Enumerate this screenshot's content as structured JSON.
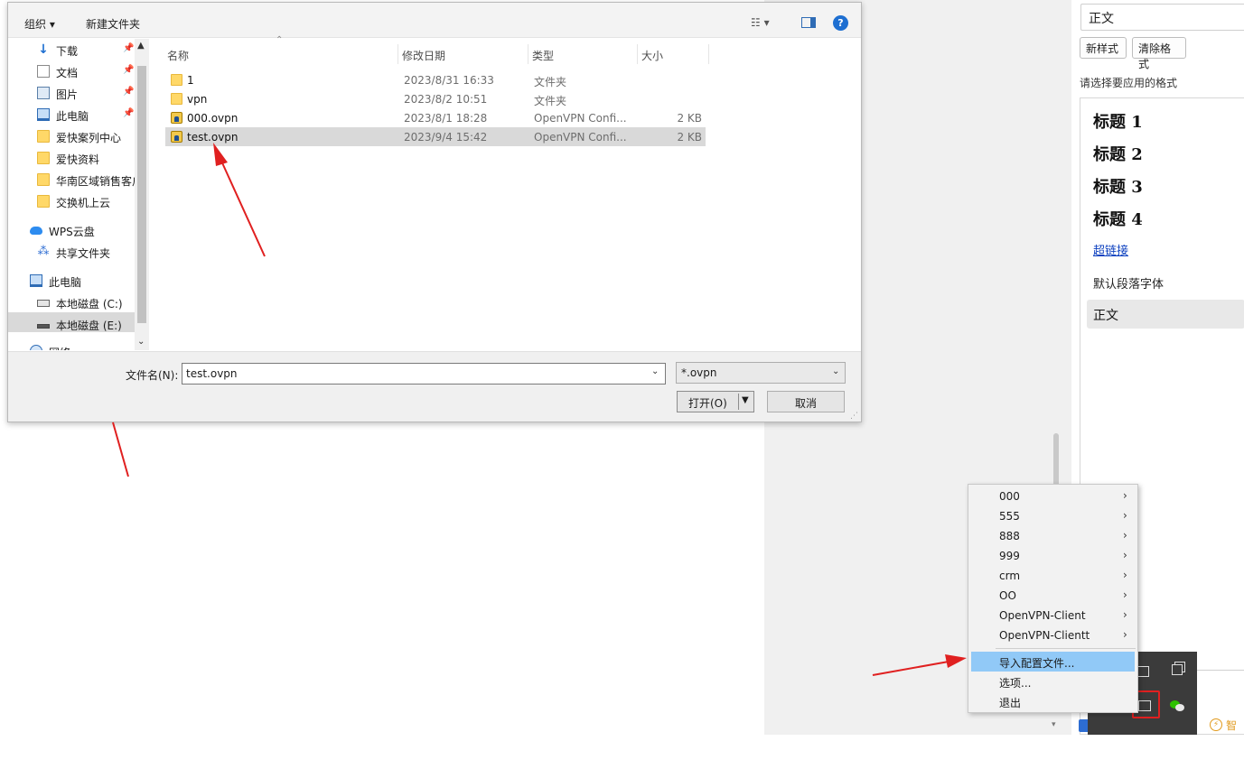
{
  "file_dialog": {
    "toolbar": {
      "organize_label": "组织 ▾",
      "new_folder_label": "新建文件夹",
      "view_menu_glyph": "☷ ▾",
      "help_glyph": "?"
    },
    "nav_items": [
      {
        "label": "下载",
        "icon": "download-icon",
        "pinned": true
      },
      {
        "label": "文档",
        "icon": "document-icon",
        "pinned": true
      },
      {
        "label": "图片",
        "icon": "pictures-icon",
        "pinned": true
      },
      {
        "label": "此电脑",
        "icon": "computer-icon",
        "pinned": true
      },
      {
        "label": "爱快案列中心",
        "icon": "folder-icon",
        "pinned": false
      },
      {
        "label": "爱快资料",
        "icon": "folder-icon",
        "pinned": false
      },
      {
        "label": "华南区域销售客户",
        "icon": "folder-icon",
        "pinned": false
      },
      {
        "label": "交换机上云",
        "icon": "folder-icon",
        "pinned": false
      },
      {
        "label": "WPS云盘",
        "icon": "cloud-icon",
        "pinned": false
      },
      {
        "label": "共享文件夹",
        "icon": "share-icon",
        "pinned": false
      },
      {
        "label": "此电脑",
        "icon": "computer-icon",
        "pinned": false
      },
      {
        "label": "本地磁盘 (C:)",
        "icon": "drive-icon",
        "pinned": false
      },
      {
        "label": "本地磁盘 (E:)",
        "icon": "drive-icon",
        "pinned": false,
        "selected": true
      },
      {
        "label": "网络",
        "icon": "network-icon",
        "pinned": false
      }
    ],
    "pin_glyph": "📌",
    "columns": {
      "name": "名称",
      "date": "修改日期",
      "type": "类型",
      "size": "大小"
    },
    "files": [
      {
        "name": "1",
        "date": "2023/8/31 16:33",
        "type": "文件夹",
        "size": "",
        "icon": "folder-icon"
      },
      {
        "name": "vpn",
        "date": "2023/8/2 10:51",
        "type": "文件夹",
        "size": "",
        "icon": "folder-icon"
      },
      {
        "name": "000.ovpn",
        "date": "2023/8/1 18:28",
        "type": "OpenVPN Confi...",
        "size": "2 KB",
        "icon": "ovpn-file-icon"
      },
      {
        "name": "test.ovpn",
        "date": "2023/9/4 15:42",
        "type": "OpenVPN Confi...",
        "size": "2 KB",
        "icon": "ovpn-file-icon",
        "selected": true
      }
    ],
    "footer": {
      "filename_label": "文件名(N):",
      "filename_value": "test.ovpn",
      "filter_value": "*.ovpn",
      "open_label": "打开(O)",
      "cancel_label": "取消"
    }
  },
  "styles_panel": {
    "current_style": "正文",
    "new_style_label": "新样式",
    "clear_format_label": "清除格式",
    "apply_prompt": "请选择要应用的格式",
    "headings": [
      "标题 1",
      "标题 2",
      "标题 3",
      "标题 4"
    ],
    "hyperlink": "超链接",
    "default_font": "默认段落字体",
    "body_style": "正文",
    "smart_text": "智"
  },
  "tray_menu": {
    "profiles": [
      "000",
      "555",
      "888",
      "999",
      "crm",
      "OO",
      "OpenVPN-Client",
      "OpenVPN-Clientt"
    ],
    "import_label": "导入配置文件...",
    "options_label": "选项...",
    "exit_label": "退出"
  },
  "colors": {
    "annotation_red": "#e02020",
    "menu_highlight": "#91c9f7",
    "selection_gray": "#d9d9d9"
  }
}
